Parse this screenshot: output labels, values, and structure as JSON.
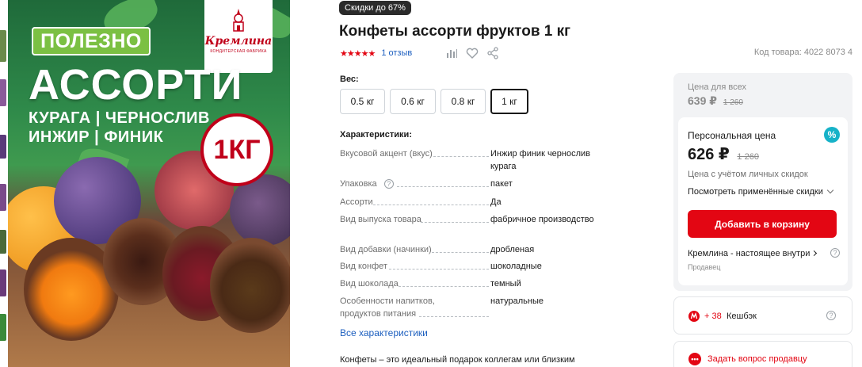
{
  "image": {
    "brand_name": "Кремлина",
    "brand_sub": "КОНДИТЕРСКАЯ ФАБРИКА",
    "tag": "ПОЛЕЗНО",
    "title": "АССОРТИ",
    "line1": "КУРАГА | ЧЕРНОСЛИВ",
    "line2": "ИНЖИР | ФИНИК",
    "weight": "1КГ"
  },
  "badge": "Скидки до 67%",
  "title": "Конфеты ассорти фруктов 1 кг",
  "rating": {
    "stars": 5,
    "reviews": "1 отзыв"
  },
  "sku": "Код товара: 4022 8073 4",
  "weight": {
    "label": "Вес:",
    "options": [
      "0.5 кг",
      "0.6 кг",
      "0.8 кг",
      "1 кг"
    ],
    "selected": "1 кг"
  },
  "characteristics": {
    "label": "Характеристики:",
    "rows": [
      {
        "name": "Вкусовой акцент (вкус)",
        "value": "Инжир финик чернослив курага"
      },
      {
        "name": "Упаковка",
        "value": "пакет"
      },
      {
        "name": "Ассорти",
        "value": "Да"
      },
      {
        "name": "Вид выпуска товара",
        "value": "фабричное производство"
      },
      {
        "name": "Вид добавки (начинки)",
        "value": "дробленая"
      },
      {
        "name": "Вид конфет",
        "value": "шоколадные"
      },
      {
        "name": "Вид шоколада",
        "value": "темный"
      },
      {
        "name": "Особенности напитков, продуктов питания",
        "value": "натуральные"
      }
    ],
    "all_link": "Все характеристики"
  },
  "description": "Конфеты – это идеальный подарок коллегам или близким",
  "price": {
    "all_label": "Цена для всех",
    "all_price": "639 ₽",
    "all_old": "1 260",
    "personal_label": "Персональная цена",
    "personal_icon": "%",
    "personal_price": "626 ₽",
    "personal_old": "1 260",
    "personal_note": "Цена с учётом личных скидок",
    "see_discounts": "Посмотреть применённые скидки",
    "add_to_cart": "Добавить в корзину",
    "seller_name": "Кремлина - настоящее внутри",
    "seller_role": "Продавец"
  },
  "cashback": {
    "amount": "+ 38",
    "label": "Кешбэк"
  },
  "ask_seller": "Задать вопрос продавцу",
  "colors": {
    "accent": "#e30613",
    "link": "#1d5fbf",
    "teal": "#16b2c8",
    "panel": "#f2f3f5"
  },
  "icons": [
    "bar-chart-icon",
    "heart-icon",
    "share-icon",
    "help-icon",
    "chevron-down-icon",
    "chevron-right-icon",
    "cashback-icon",
    "chat-icon",
    "percent-icon"
  ]
}
